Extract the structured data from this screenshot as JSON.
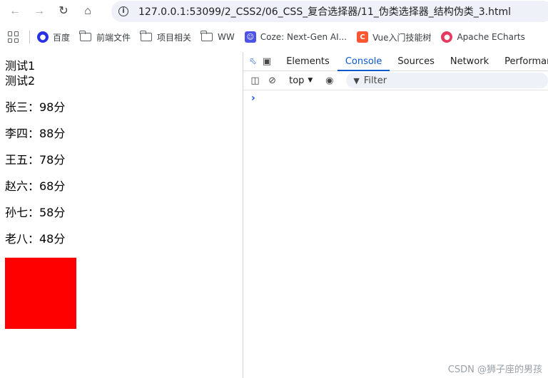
{
  "browser": {
    "url": "127.0.0.1:53099/2_CSS2/06_CSS_复合选择器/11_伪类选择器_结构伪类_3.html"
  },
  "bookmarks": [
    {
      "label": "百度",
      "icon": "baidu-paw-icon"
    },
    {
      "label": "前端文件",
      "icon": "folder-icon"
    },
    {
      "label": "项目相关",
      "icon": "folder-icon"
    },
    {
      "label": "WW",
      "icon": "folder-icon"
    },
    {
      "label": "Coze: Next-Gen AI...",
      "icon": "coze-icon"
    },
    {
      "label": "Vue入门技能树",
      "icon": "csdn-icon"
    },
    {
      "label": "Apache ECharts",
      "icon": "echarts-icon"
    }
  ],
  "page": {
    "test_lines": [
      "测试1",
      "测试2"
    ],
    "scores": [
      "张三：98分",
      "李四：88分",
      "王五：78分",
      "赵六：68分",
      "孙七：58分",
      "老八：48分"
    ],
    "box_color": "#ff0000"
  },
  "devtools": {
    "tabs": [
      "Elements",
      "Console",
      "Sources",
      "Network",
      "Performance"
    ],
    "active_tab": "Console",
    "context": "top",
    "filter_placeholder": "Filter"
  },
  "watermark": "CSDN @狮子座的男孩"
}
